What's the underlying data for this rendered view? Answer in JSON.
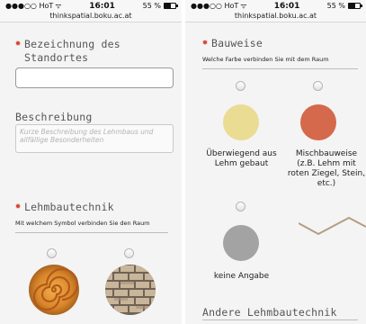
{
  "status": {
    "carrier": "●●●○○ HoT",
    "wifi": "ᯤ",
    "time": "16:01",
    "battery": "55 %",
    "url": "thinkspatial.boku.ac.at"
  },
  "left": {
    "location_title": "Bezeichnung des Standortes",
    "location_value": "",
    "description_title": "Beschreibung",
    "description_placeholder": "Kurze Beschreibung des Lehmbaus und allfällige Besonderheiten",
    "technique_title": "Lehmbautechnik",
    "technique_question": "Mit welchem Symbol verbinden Sie den Raum",
    "technique_options": [
      {
        "icon": "spiral-texture-icon",
        "selected": false
      },
      {
        "icon": "brick-wall-texture-icon",
        "selected": false
      }
    ]
  },
  "right": {
    "construction_title": "Bauweise",
    "construction_question": "Welche Farbe verbinden Sie mit dem Raum",
    "options": [
      {
        "label": "Überwiegend aus Lehm gebaut",
        "color": "#eadc93",
        "selected": false
      },
      {
        "label": "Mischbauweise (z.B. Lehm mit roten Ziegel, Stein, etc.)",
        "color": "#d4694b",
        "selected": false
      },
      {
        "label": "keine Angabe",
        "color": "#a3a3a3",
        "selected": false
      }
    ],
    "other_title": "Andere Lehmbautechnik"
  }
}
